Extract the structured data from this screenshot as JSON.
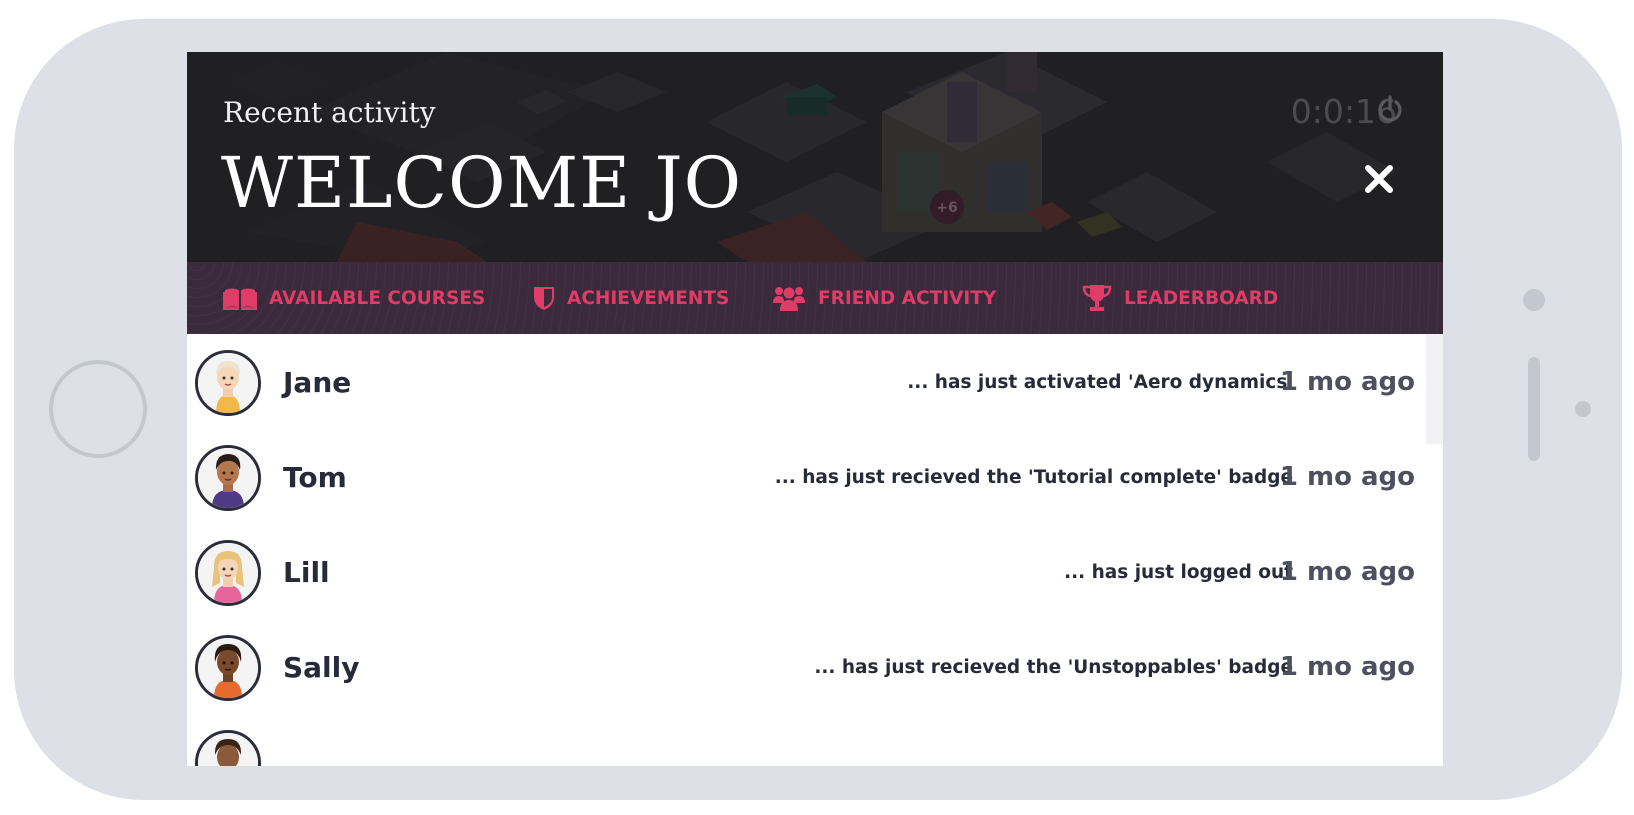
{
  "header": {
    "subtitle": "Recent activity",
    "title": "WELCOME JO",
    "timer": "0:0:16",
    "power_icon": "power-icon",
    "close_icon": "close-icon",
    "scene_badge": "+6"
  },
  "tabs": [
    {
      "label": "AVAILABLE COURSES",
      "icon": "book-icon"
    },
    {
      "label": "ACHIEVEMENTS",
      "icon": "shield-icon"
    },
    {
      "label": "FRIEND ACTIVITY",
      "icon": "users-icon"
    },
    {
      "label": "LEADERBOARD",
      "icon": "trophy-icon"
    }
  ],
  "activity_feed": [
    {
      "name": "Jane",
      "activity": "... has just activated 'Aero dynamics'",
      "time": "1 mo ago"
    },
    {
      "name": "Tom",
      "activity": "... has just recieved the 'Tutorial complete' badge",
      "time": "1 mo ago"
    },
    {
      "name": "Lill",
      "activity": "... has just logged out",
      "time": "1 mo ago"
    },
    {
      "name": "Sally",
      "activity": "... has just recieved the 'Unstoppables' badge",
      "time": "1 mo ago"
    }
  ],
  "colors": {
    "accent": "#e03c68",
    "tab_bar": "#3a2a3c",
    "hero": "#27272b",
    "text_dark": "#272a39",
    "device": "#dde0e6"
  }
}
